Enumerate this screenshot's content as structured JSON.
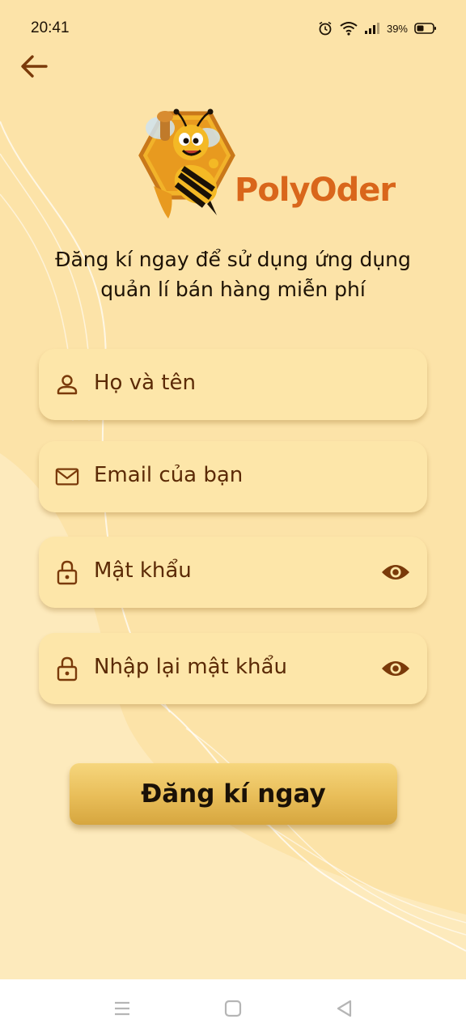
{
  "status_bar": {
    "time": "20:41",
    "battery": "39%",
    "icons": [
      "alarm-icon",
      "wifi-icon",
      "signal-icon",
      "battery-icon"
    ]
  },
  "header": {
    "back_icon": "arrow-left-icon"
  },
  "logo": {
    "brand": "PolyOder",
    "mascot": "bee-mascot"
  },
  "subtitle": {
    "line1": "Đăng kí ngay để sử dụng ứng dụng",
    "line2": "quản lí bán hàng miễn phí"
  },
  "form": {
    "fields": [
      {
        "placeholder": "Họ và tên",
        "icon": "person-icon"
      },
      {
        "placeholder": "Email của bạn",
        "icon": "mail-icon"
      },
      {
        "placeholder": "Mật khẩu",
        "icon": "lock-icon",
        "toggle": "eye-icon"
      },
      {
        "placeholder": "Nhập lại mật khẩu",
        "icon": "lock-icon",
        "toggle": "eye-icon"
      }
    ],
    "submit_label": "Đăng kí ngay"
  },
  "nav_bar": {
    "buttons": [
      "menu-icon",
      "home-icon",
      "back-icon"
    ]
  },
  "colors": {
    "background": "#fce3a8",
    "field_bg": "#fde6a9",
    "icon_brown": "#7a3a0a",
    "brand_orange": "#d9661b",
    "button_gold": "#e8bd58"
  }
}
